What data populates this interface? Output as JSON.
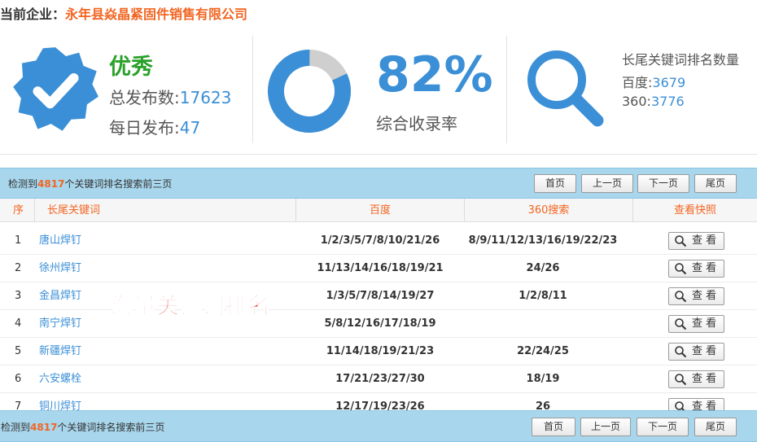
{
  "company": {
    "label": "当前企业：",
    "name": "永年县焱晶紧固件销售有限公司"
  },
  "stats": {
    "level": "优秀",
    "total_label": "总发布数:",
    "total_value": "17623",
    "daily_label": "每日发布:",
    "daily_value": "47",
    "rate_value": "82%",
    "rate_fraction": 0.82,
    "rate_label": "综合收录率",
    "kw_title": "长尾关键词排名数量",
    "baidu_label": "百度:",
    "baidu_value": "3679",
    "s360_label": "360:",
    "s360_value": "3776"
  },
  "colors": {
    "accent_blue": "#3b8fd6",
    "orange": "#f26522",
    "green": "#2aa12a",
    "bar_blue": "#a8d6ec",
    "overlay_red": "#e51c1c"
  },
  "icons": {
    "badge": "verified-check-icon",
    "donut": "donut-progress-icon",
    "search": "magnifier-icon"
  },
  "summary": {
    "prefix": "检测到",
    "count": "4817",
    "suffix": "个关键词排名搜索前三页"
  },
  "pager": {
    "first": "首页",
    "prev": "上一页",
    "next": "下一页",
    "last": "尾页"
  },
  "table": {
    "headers": {
      "idx": "序",
      "keyword": "长尾关键词",
      "baidu": "百度",
      "s360": "360搜索",
      "snapshot": "查看快照"
    },
    "view_label": "查 看",
    "rows": [
      {
        "idx": "1",
        "keyword": "唐山焊钉",
        "baidu": "1/2/3/5/7/8/10/21/26",
        "s360": "8/9/11/12/13/16/19/22/23"
      },
      {
        "idx": "2",
        "keyword": "徐州焊钉",
        "baidu": "11/13/14/16/18/19/21",
        "s360": "24/26"
      },
      {
        "idx": "3",
        "keyword": "金昌焊钉",
        "baidu": "1/3/5/7/8/14/19/27",
        "s360": "1/2/8/11"
      },
      {
        "idx": "4",
        "keyword": "南宁焊钉",
        "baidu": "5/8/12/16/17/18/19",
        "s360": ""
      },
      {
        "idx": "5",
        "keyword": "新疆焊钉",
        "baidu": "11/14/18/19/21/23",
        "s360": "22/24/25"
      },
      {
        "idx": "6",
        "keyword": "六安螺栓",
        "baidu": "17/21/23/27/30",
        "s360": "18/19"
      },
      {
        "idx": "7",
        "keyword": "铜川焊钉",
        "baidu": "12/17/19/23/26",
        "s360": "26"
      }
    ]
  },
  "overlay_text": "海量关键词排名"
}
